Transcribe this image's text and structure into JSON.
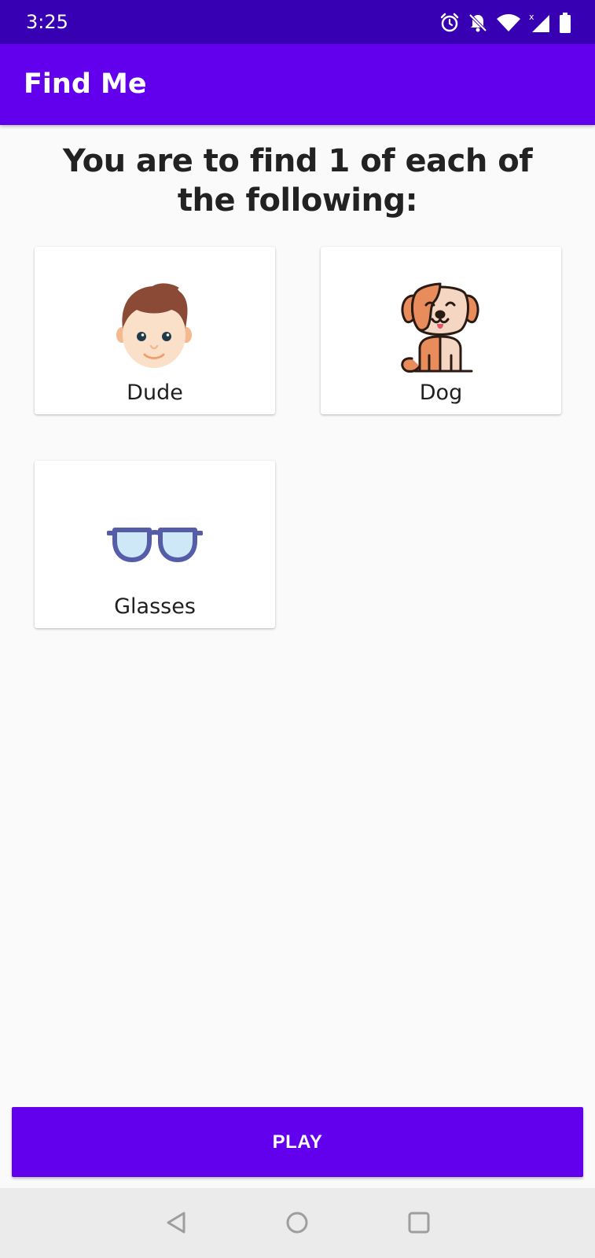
{
  "status_bar": {
    "time": "3:25",
    "icons": [
      "alarm-icon",
      "notifications-off-icon",
      "wifi-icon",
      "cellular-signal-icon",
      "battery-icon"
    ],
    "background_color": "#3700b3"
  },
  "app_bar": {
    "title": "Find Me",
    "background_color": "#6200ee"
  },
  "instructions": "You are to find 1 of each of the following:",
  "items": [
    {
      "label": "Dude",
      "icon": "boy-face-icon"
    },
    {
      "label": "Dog",
      "icon": "dog-icon"
    },
    {
      "label": "Glasses",
      "icon": "glasses-icon"
    }
  ],
  "play_button": {
    "label": "PLAY",
    "background_color": "#6200ee"
  },
  "nav_bar": {
    "icons": [
      "back-icon",
      "home-icon",
      "recents-icon"
    ]
  }
}
